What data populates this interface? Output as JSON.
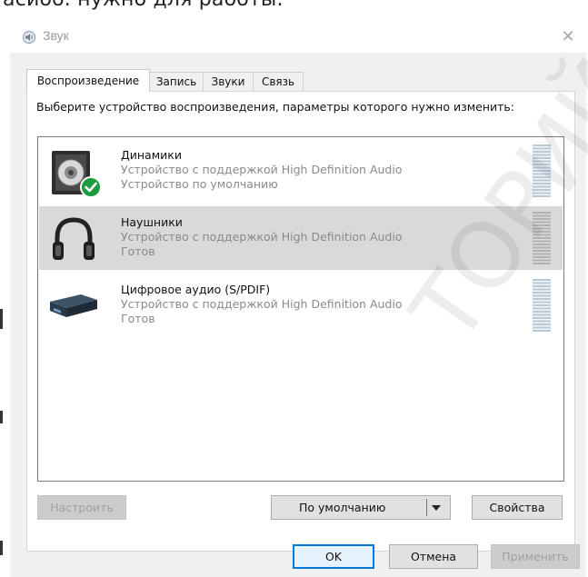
{
  "background": {
    "text": "асиоо. нужно для раооты."
  },
  "window": {
    "title": "Звук",
    "close_glyph": "✕"
  },
  "tabs": [
    {
      "label": "Воспроизведение",
      "active": true
    },
    {
      "label": "Запись",
      "active": false
    },
    {
      "label": "Звуки",
      "active": false
    },
    {
      "label": "Связь",
      "active": false
    }
  ],
  "instruction": "Выберите устройство воспроизведения, параметры которого нужно изменить:",
  "devices": [
    {
      "name": "Динамики",
      "description": "Устройство с поддержкой High Definition Audio",
      "status": "Устройство по умолчанию",
      "icon": "speaker-icon",
      "selected": false,
      "default": true
    },
    {
      "name": "Наушники",
      "description": "Устройство с поддержкой High Definition Audio",
      "status": "Готов",
      "icon": "headphones-icon",
      "selected": true,
      "default": false
    },
    {
      "name": "Цифровое аудио (S/PDIF)",
      "description": "Устройство с поддержкой High Definition Audio",
      "status": "Готов",
      "icon": "digital-audio-icon",
      "selected": false,
      "default": false
    }
  ],
  "buttons": {
    "configure": "Настроить",
    "set_default": "По умолчанию",
    "properties": "Свойства",
    "ok": "OK",
    "cancel": "Отмена",
    "apply": "Применить"
  },
  "watermark": "ТОРИЙ",
  "colors": {
    "focus_border": "#0078d7",
    "check_green": "#1a9c3e"
  }
}
